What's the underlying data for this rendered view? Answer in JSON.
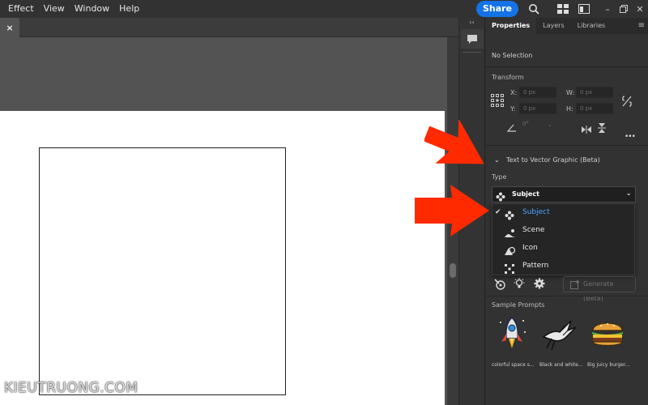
{
  "menubar": {
    "items": [
      "Effect",
      "View",
      "Window",
      "Help"
    ],
    "share_label": "Share",
    "icons": [
      "search-icon",
      "arrange-documents-icon",
      "panel-layout-icon"
    ],
    "window_controls": [
      "minimize-icon",
      "restore-icon",
      "close-icon"
    ]
  },
  "document_tab": {
    "close_label": "×"
  },
  "panel": {
    "tabs": [
      "Properties",
      "Layers",
      "Libraries"
    ],
    "active_tab": "Properties",
    "selection_status": "No Selection",
    "transform": {
      "title": "Transform",
      "x_label": "X:",
      "x_value": "0 px",
      "y_label": "Y:",
      "y_value": "0 px",
      "w_label": "W:",
      "w_value": "0 px",
      "h_label": "H:",
      "h_value": "0 px",
      "angle_value": "0°"
    },
    "text_to_vector": {
      "title": "Text to Vector Graphic (Beta)",
      "type_label": "Type",
      "selected_type": "Subject",
      "options": [
        "Subject",
        "Scene",
        "Icon",
        "Pattern"
      ],
      "generate_label": "Generate (Beta)"
    },
    "sample_prompts": {
      "title": "Sample Prompts",
      "items": [
        "colorful space s...",
        "Black and white...",
        "Big juicy burger..."
      ]
    }
  },
  "watermark": "KIEUTRUONG.COM",
  "colors": {
    "accent": "#1473e6",
    "selected_option": "#4aa3ff",
    "annotation_arrow": "#ff2a00"
  }
}
